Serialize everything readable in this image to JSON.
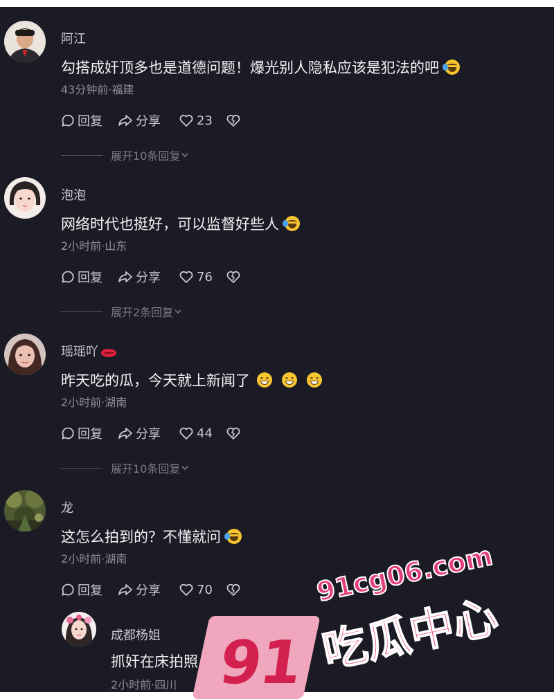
{
  "comments": [
    {
      "username": "阿江",
      "text": "勾搭成奸顶多也是道德问题！爆光别人隐私应该是犯法的吧",
      "emojis": [
        "laughing-crying-emoji"
      ],
      "meta": "43分钟前·福建",
      "reply_label": "回复",
      "share_label": "分享",
      "likes": "23",
      "expand_label": "展开10条回复"
    },
    {
      "username": "泡泡",
      "text": "网络时代也挺好，可以监督好些人",
      "emojis": [
        "laughing-crying-emoji"
      ],
      "meta": "2小时前·山东",
      "reply_label": "回复",
      "share_label": "分享",
      "likes": "76",
      "expand_label": "展开2条回复"
    },
    {
      "username": "瑶瑶吖",
      "username_badge": "lips-icon",
      "text": "昨天吃的瓜，今天就上新闻了",
      "emojis": [
        "grinning-emoji",
        "grinning-emoji",
        "grinning-emoji"
      ],
      "meta": "2小时前·湖南",
      "reply_label": "回复",
      "share_label": "分享",
      "likes": "44",
      "expand_label": "展开10条回复"
    },
    {
      "username": "龙",
      "text": "这怎么拍到的？不懂就问",
      "emojis": [
        "laughing-crying-emoji"
      ],
      "meta": "2小时前·湖南",
      "reply_label": "回复",
      "share_label": "分享",
      "likes": "70"
    }
  ],
  "reply": {
    "username": "成都杨姐",
    "text": "抓奸在床拍照",
    "meta": "2小时前·四川"
  },
  "watermark": {
    "number": "91",
    "url": "91cg06.com",
    "name": "吃瓜中心"
  },
  "colors": {
    "background": "#1b1b25",
    "text_primary": "#f2f2f5",
    "text_secondary": "#8e8e99",
    "watermark_pink": "#e3407a"
  }
}
